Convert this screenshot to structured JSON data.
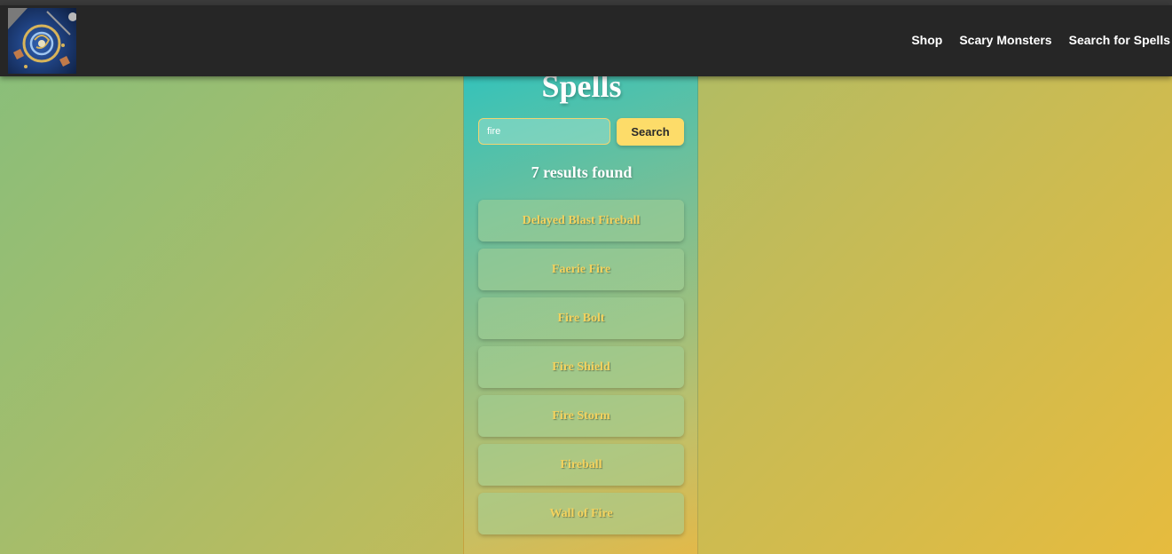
{
  "header": {
    "logo_icon": "dragon-dice-logo-icon",
    "nav": [
      {
        "label": "Shop"
      },
      {
        "label": "Scary Monsters"
      },
      {
        "label": "Search for Spells"
      }
    ]
  },
  "spells": {
    "title": "Spells",
    "search": {
      "value": "fire",
      "button_label": "Search"
    },
    "results_count": "7 results found",
    "results": [
      {
        "name": "Delayed Blast Fireball"
      },
      {
        "name": "Faerie Fire"
      },
      {
        "name": "Fire Bolt"
      },
      {
        "name": "Fire Shield"
      },
      {
        "name": "Fire Storm"
      },
      {
        "name": "Fireball"
      },
      {
        "name": "Wall of Fire"
      }
    ]
  },
  "colors": {
    "navbar": "#262626",
    "accent_yellow": "#fddc69",
    "result_text": "#f3d25e",
    "background_start": "#86bf7c",
    "background_end": "#e6bb3e"
  }
}
